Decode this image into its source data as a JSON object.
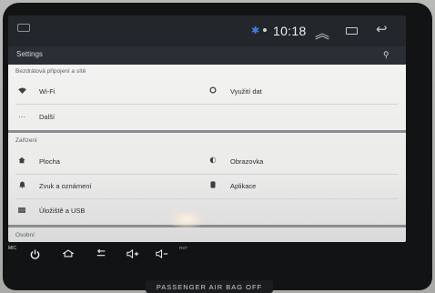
{
  "statusbar": {
    "time": "10:18",
    "bluetooth_icon": "bluetooth-icon",
    "signal_icon": "signal-dot-icon",
    "expand_icon": "chevron-up-icon",
    "recent_icon": "recent-apps-icon",
    "back_icon": "back-icon"
  },
  "appbar": {
    "title": "Settings",
    "search_icon": "search-icon"
  },
  "sections": [
    {
      "header": "Bezdrátová připojení a sítě",
      "rows": [
        {
          "left": {
            "icon": "wifi-icon",
            "label": "Wi-Fi"
          },
          "right": {
            "icon": "data-usage-icon",
            "label": "Využití dat"
          }
        },
        {
          "left": {
            "icon": "more-icon",
            "label": "Další"
          }
        }
      ]
    },
    {
      "header": "Zařízení",
      "rows": [
        {
          "left": {
            "icon": "home-icon",
            "label": "Plocha"
          },
          "right": {
            "icon": "display-icon",
            "label": "Obrazovka"
          }
        },
        {
          "left": {
            "icon": "bell-icon",
            "label": "Zvuk a oznámení"
          },
          "right": {
            "icon": "apps-icon",
            "label": "Aplikace"
          }
        },
        {
          "left": {
            "icon": "storage-icon",
            "label": "Úložiště a USB"
          }
        }
      ]
    },
    {
      "header": "Osobní"
    }
  ],
  "hardware": {
    "mic_label": "MIC",
    "rst_label": "RST",
    "buttons": [
      "power-icon",
      "home-icon",
      "back-icon",
      "volume-up-icon",
      "volume-down-icon"
    ]
  },
  "airbag_label": "PASSENGER AIR BAG OFF"
}
